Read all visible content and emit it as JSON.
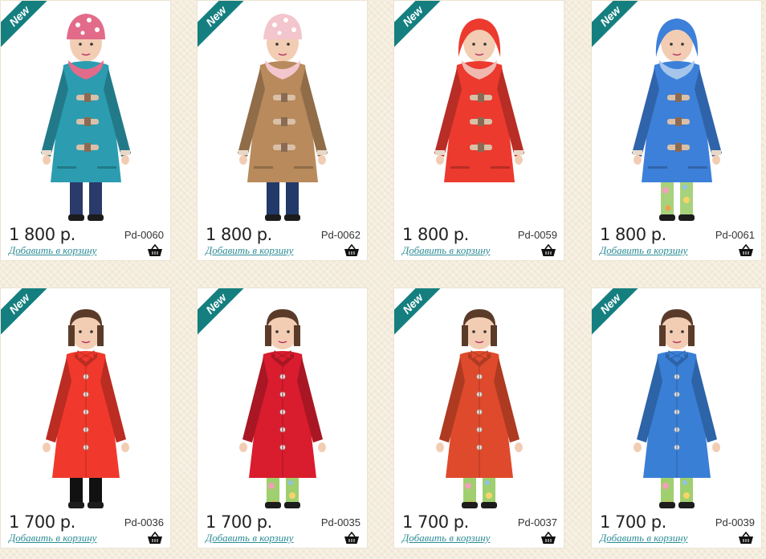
{
  "products": [
    {
      "badge": "New",
      "price": "1 800 р.",
      "sku": "Pd-0060",
      "cart_label": "Добавить в корзину",
      "coat_color": "#2c9db0",
      "style": "duffle",
      "accent": "#e36b8a",
      "legs": "#2a3a6a",
      "hat": true,
      "hood": false
    },
    {
      "badge": "New",
      "price": "1 800 р.",
      "sku": "Pd-0062",
      "cart_label": "Добавить в корзину",
      "coat_color": "#b88a5c",
      "style": "duffle",
      "accent": "#f3c5cd",
      "legs": "#223a6a",
      "hat": true,
      "hood": false
    },
    {
      "badge": "New",
      "price": "1 800 р.",
      "sku": "Pd-0059",
      "cart_label": "Добавить в корзину",
      "coat_color": "#ec3a2f",
      "style": "duffle",
      "accent": "#f0b9b0",
      "legs": "#ffffff",
      "hat": false,
      "hood": true
    },
    {
      "badge": "New",
      "price": "1 800 р.",
      "sku": "Pd-0061",
      "cart_label": "Добавить в корзину",
      "coat_color": "#3d80da",
      "style": "duffle",
      "accent": "#a5c6ea",
      "legs": "#a7d27c",
      "hat": false,
      "hood": true
    },
    {
      "badge": "New",
      "price": "1 700 р.",
      "sku": "Pd-0036",
      "cart_label": "Добавить в корзину",
      "coat_color": "#f0392c",
      "style": "button",
      "accent": "#f0392c",
      "legs": "#111111",
      "hat": false,
      "hood": false
    },
    {
      "badge": "New",
      "price": "1 700 р.",
      "sku": "Pd-0035",
      "cart_label": "Добавить в корзину",
      "coat_color": "#d91c2e",
      "style": "button",
      "accent": "#d91c2e",
      "legs": "#9fcf6e",
      "hat": false,
      "hood": false
    },
    {
      "badge": "New",
      "price": "1 700 р.",
      "sku": "Pd-0037",
      "cart_label": "Добавить в корзину",
      "coat_color": "#df4a2c",
      "style": "button",
      "accent": "#df4a2c",
      "legs": "#9fcf6e",
      "hat": false,
      "hood": false
    },
    {
      "badge": "New",
      "price": "1 700 р.",
      "sku": "Pd-0039",
      "cart_label": "Добавить в корзину",
      "coat_color": "#3a7fd6",
      "style": "button",
      "accent": "#3a7fd6",
      "legs": "#9fcf6e",
      "hat": false,
      "hood": false
    }
  ]
}
